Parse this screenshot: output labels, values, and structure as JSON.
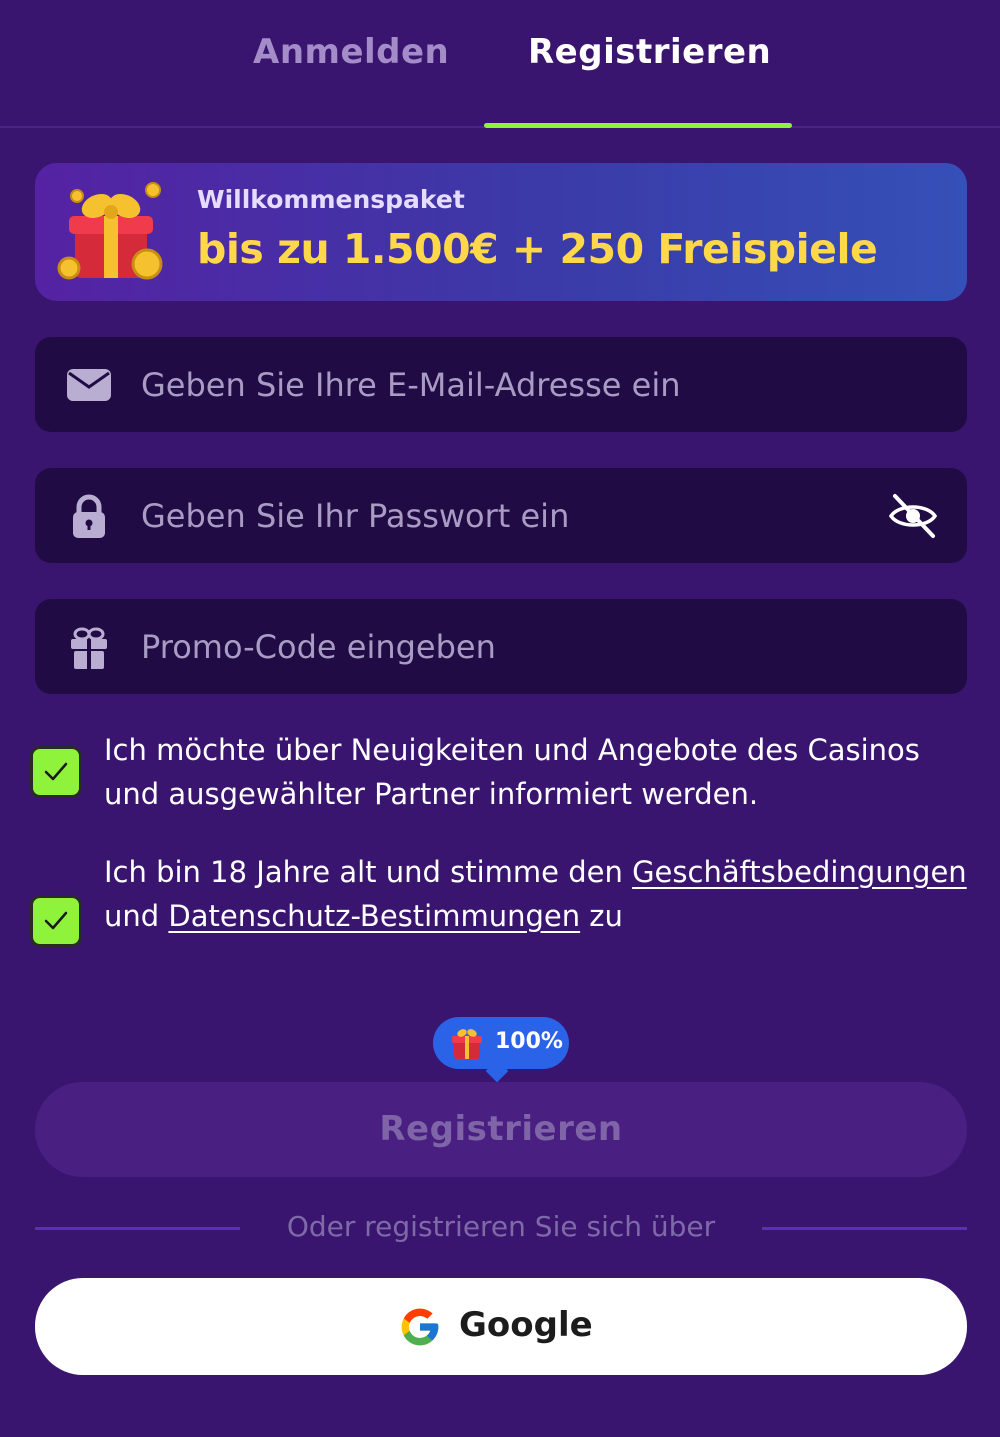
{
  "tabs": {
    "login": "Anmelden",
    "register": "Registrieren"
  },
  "banner": {
    "subtitle": "Willkommenspaket",
    "title": "bis zu 1.500€ + 250 Freispiele"
  },
  "form": {
    "email_placeholder": "Geben Sie Ihre E-Mail-Adresse ein",
    "password_placeholder": "Geben Sie Ihr Passwort ein",
    "promo_placeholder": "Promo-Code eingeben"
  },
  "consents": {
    "news_text": "Ich möchte über Neuigkeiten und Angebote des Casinos und ausgewählter Partner informiert werden.",
    "news_checked": true,
    "terms_prefix": "Ich bin 18 Jahre alt und stimme den ",
    "terms_link": "Geschäftsbedingungen",
    "terms_middle": " und ",
    "privacy_link": "Datenschutz-Bestimmungen",
    "terms_suffix": " zu",
    "terms_checked": true
  },
  "bonus_pill": {
    "text": "100%"
  },
  "register_button": "Registrieren",
  "divider_text": "Oder registrieren Sie sich über",
  "google_button": "Google",
  "colors": {
    "background": "#3a1570",
    "accent_green": "#8ff23b",
    "banner_gold": "#ffd84a",
    "field_bg": "#210b45",
    "pill_blue": "#2a62e8"
  },
  "icons": {
    "email": "envelope-icon",
    "password": "lock-icon",
    "visibility": "eye-slash-icon",
    "promo": "gift-icon",
    "banner": "gift-box-coins-icon",
    "google": "google-g-icon"
  }
}
